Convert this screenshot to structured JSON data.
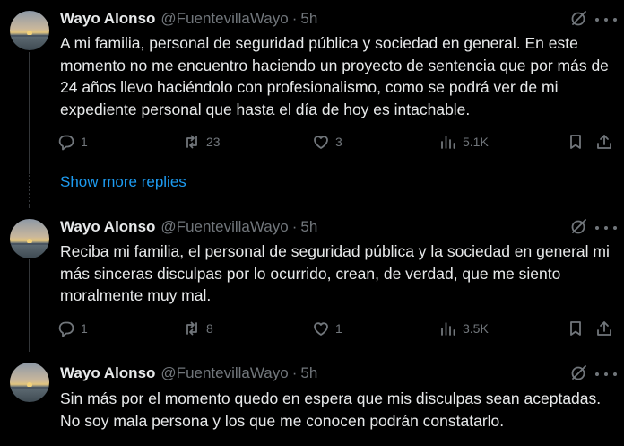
{
  "colors": {
    "background": "#000000",
    "text": "#e7e9ea",
    "muted": "#71767b",
    "accent": "#1d9bf0"
  },
  "tweets": [
    {
      "name": "Wayo Alonso",
      "handle": "@FuentevillaWayo",
      "separator": "·",
      "time": "5h",
      "text": "A mi familia, personal de seguridad pública y sociedad en general. En este momento no me encuentro haciendo un proyecto de sentencia que por más de 24 años llevo haciéndolo con profesionalismo, como se podrá ver de mi expediente personal que hasta el día de hoy es intachable.",
      "replies": "1",
      "reposts": "23",
      "likes": "3",
      "views": "5.1K"
    },
    {
      "name": "Wayo Alonso",
      "handle": "@FuentevillaWayo",
      "separator": "·",
      "time": "5h",
      "text": "Reciba mi familia, el personal de seguridad pública y la sociedad en general mi más sinceras disculpas por lo ocurrido, crean, de verdad, que me siento moralmente muy mal.",
      "replies": "1",
      "reposts": "8",
      "likes": "1",
      "views": "3.5K"
    },
    {
      "name": "Wayo Alonso",
      "handle": "@FuentevillaWayo",
      "separator": "·",
      "time": "5h",
      "text": "Sin más por el momento quedo en espera que mis disculpas sean aceptadas. No soy mala persona y los que me conocen podrán constatarlo."
    }
  ],
  "show_more_replies": "Show more replies",
  "icons": {
    "reply": "reply-icon",
    "repost": "repost-icon",
    "like": "heart-icon",
    "views": "views-icon",
    "bookmark": "bookmark-icon",
    "share": "share-icon",
    "grok": "grok-icon",
    "more": "more-icon"
  }
}
